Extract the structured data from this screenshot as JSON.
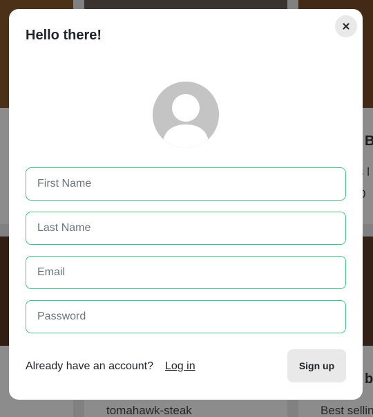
{
  "modal": {
    "title": "Hello there!",
    "close_icon": "close-icon",
    "avatar_icon": "user-avatar-icon",
    "fields": {
      "first_name": {
        "placeholder": "First Name",
        "value": ""
      },
      "last_name": {
        "placeholder": "Last Name",
        "value": ""
      },
      "email": {
        "placeholder": "Email",
        "value": ""
      },
      "password": {
        "placeholder": "Password",
        "value": ""
      }
    },
    "footer": {
      "prompt": "Already have an account?",
      "login_label": "Log in",
      "signup_label": "Sign up"
    }
  },
  "background": {
    "card_right_title_fragment": "B",
    "card_right_text_fragment": "s l",
    "card_right_price_fragment": "0",
    "card_bottom_right_title_fragment": "b",
    "card_bottom_middle_text": "tomahawk-steak",
    "card_bottom_right_text": "Best sellin"
  },
  "colors": {
    "accent_border": "#3ec286",
    "button_bg": "#e9e9e9",
    "avatar_bg": "#c4c4c4"
  }
}
